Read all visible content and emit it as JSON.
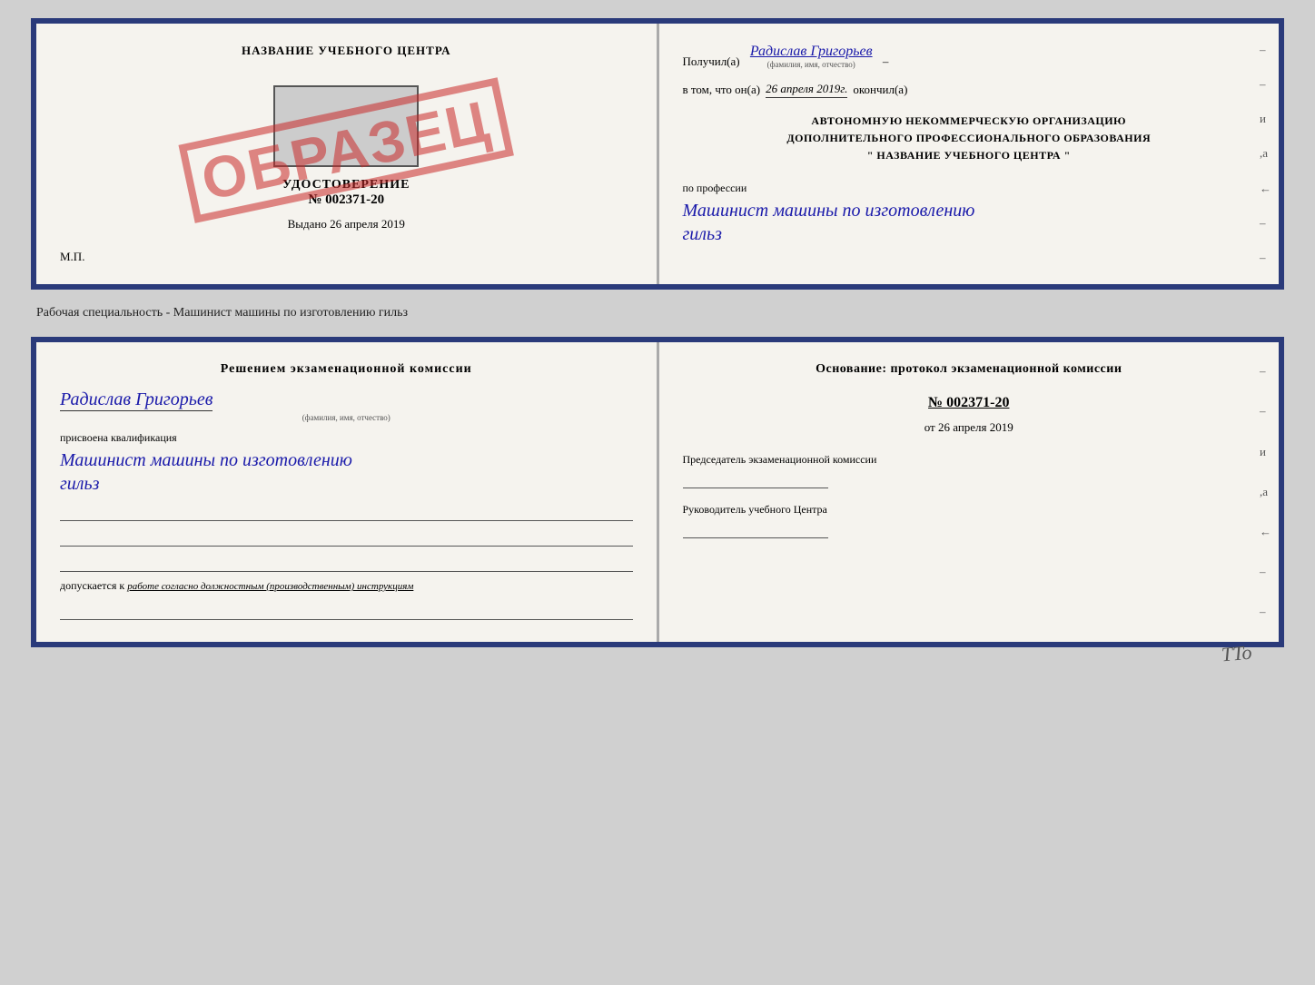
{
  "card1": {
    "left": {
      "title": "НАЗВАНИЕ УЧЕБНОГО ЦЕНТРА",
      "stamp": "ОБРАЗЕЦ",
      "cert_label": "УДОСТОВЕРЕНИЕ",
      "cert_number": "№ 002371-20",
      "vydano_label": "Выдано",
      "vydano_date": "26 апреля 2019",
      "mp_label": "М.П."
    },
    "right": {
      "poluchil_prefix": "Получил(а)",
      "poluchil_name": "Радислав Григорьев",
      "fio_hint": "(фамилия, имя, отчество)",
      "dash1": "–",
      "vtom_prefix": "в том, что он(а)",
      "vtom_date": "26 апреля 2019г.",
      "vtom_suffix": "окончил(а)",
      "org_line1": "АВТОНОМНУЮ НЕКОММЕРЧЕСКУЮ ОРГАНИЗАЦИЮ",
      "org_line2": "ДОПОЛНИТЕЛЬНОГО ПРОФЕССИОНАЛЬНОГО ОБРАЗОВАНИЯ",
      "org_quote_open": "\"",
      "org_name": "НАЗВАНИЕ УЧЕБНОГО ЦЕНТРА",
      "org_quote_close": "\"",
      "po_professii": "по профессии",
      "profession_line1": "Машинист машины по изготовлению",
      "profession_line2": "гильз",
      "side_dashes": [
        "-",
        "-",
        "-",
        "и",
        "а",
        "←",
        "-",
        "-"
      ]
    }
  },
  "separator": "Рабочая специальность - Машинист машины по изготовлению гильз",
  "card2": {
    "left": {
      "resheniem_title": "Решением  экзаменационной  комиссии",
      "name": "Радислав Григорьев",
      "fio_hint": "(фамилия, имя, отчество)",
      "prisvoyena": "присвоена квалификация",
      "qualification_line1": "Машинист машины по изготовлению",
      "qualification_line2": "гильз",
      "dopuskaetsya_prefix": "допускается к",
      "dopuskaetsya_text": "работе согласно должностным (производственным) инструкциям"
    },
    "right": {
      "osnovanie_title": "Основание: протокол экзаменационной  комиссии",
      "number_label": "№  002371-20",
      "ot_label": "от",
      "ot_date": "26 апреля 2019",
      "predsedatel_label": "Председатель экзаменационной комиссии",
      "rukovoditel_label": "Руководитель учебного Центра",
      "side_dashes": [
        "-",
        "-",
        "-",
        "и",
        "а",
        "←",
        "-",
        "-"
      ]
    }
  },
  "tto_mark": "TTo"
}
